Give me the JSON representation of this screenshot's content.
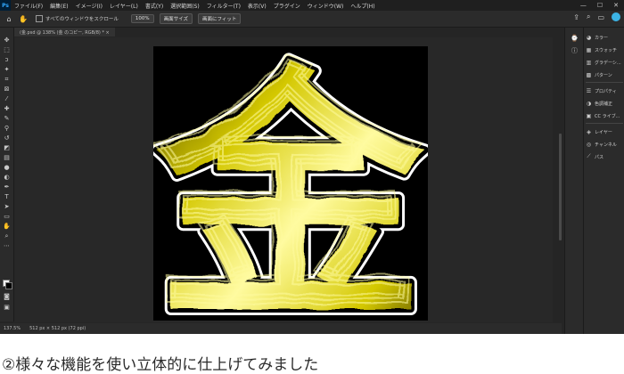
{
  "app": {
    "logo": "Ps",
    "menu": [
      "ファイル(F)",
      "編集(E)",
      "イメージ(I)",
      "レイヤー(L)",
      "書式(Y)",
      "選択範囲(S)",
      "フィルター(T)",
      "表示(V)",
      "プラグイン",
      "ウィンドウ(W)",
      "ヘルプ(H)"
    ],
    "window_controls": [
      "—",
      "☐",
      "✕"
    ]
  },
  "options_bar": {
    "scroll_all_label": "すべてのウィンドウをスクロール",
    "zoom_100": "100%",
    "fit_screen": "画面サイズ",
    "fill_screen": "画面にフィット"
  },
  "document": {
    "tab_title": "(金.psd @ 138% (金 のコピー, RGB/8) * ×"
  },
  "canvas": {
    "glyph": "金",
    "colors": {
      "metal": "#d4c800",
      "highlight": "#fffba0",
      "shadow": "#3a3400",
      "outline": "#ffffff"
    }
  },
  "status": {
    "zoom": "137.5%",
    "doc_size": "512 px × 512 px (72 ppi)"
  },
  "panels": {
    "group1": [
      {
        "icon": "color-icon",
        "label": "カラー"
      },
      {
        "icon": "swatches-icon",
        "label": "スウォッチ"
      },
      {
        "icon": "gradients-icon",
        "label": "グラデーシ..."
      },
      {
        "icon": "patterns-icon",
        "label": "パターン"
      }
    ],
    "group2": [
      {
        "icon": "properties-icon",
        "label": "プロパティ"
      },
      {
        "icon": "adjustments-icon",
        "label": "色調補正"
      },
      {
        "icon": "libraries-icon",
        "label": "CC ライブ..."
      }
    ],
    "group3": [
      {
        "icon": "layers-icon",
        "label": "レイヤー"
      },
      {
        "icon": "channels-icon",
        "label": "チャンネル"
      },
      {
        "icon": "paths-icon",
        "label": "パス"
      }
    ]
  },
  "caption": "②様々な機能を使い立体的に仕上げてみました"
}
